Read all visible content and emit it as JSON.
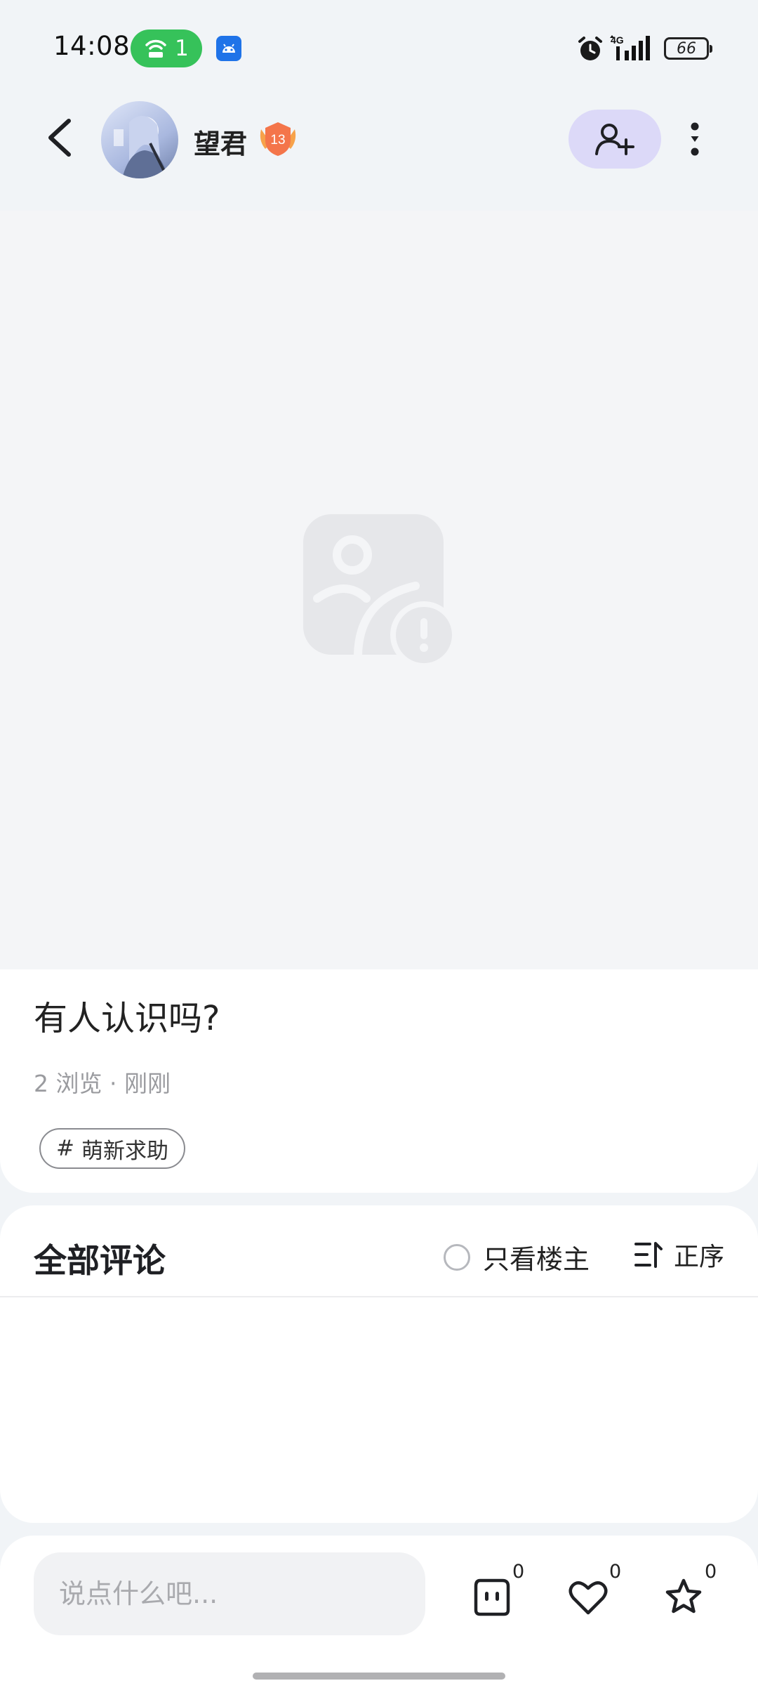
{
  "status_bar": {
    "time": "14:08",
    "hotspot_count": "1",
    "network": "4G",
    "battery": "66"
  },
  "header": {
    "username": "望君",
    "level": "13",
    "icons": [
      "back-icon",
      "avatar",
      "level-badge-icon",
      "add-friend-icon",
      "more-vertical-icon"
    ]
  },
  "media": {
    "icon": "broken-image-icon"
  },
  "post": {
    "title": "有人认识吗?",
    "meta": "2 浏览 · 刚刚",
    "tag_symbol": "#",
    "tag": "萌新求助"
  },
  "comments": {
    "heading": "全部评论",
    "op_only_label": "只看楼主",
    "sort_label": "正序"
  },
  "bottom_bar": {
    "input_placeholder": "说点什么吧...",
    "comment_count": "0",
    "like_count": "0",
    "favorite_count": "0"
  },
  "colors": {
    "accent_follow_bg": "#dcd9f8",
    "hotspot_green": "#36c25a",
    "page_bg": "#f1f4f7"
  }
}
